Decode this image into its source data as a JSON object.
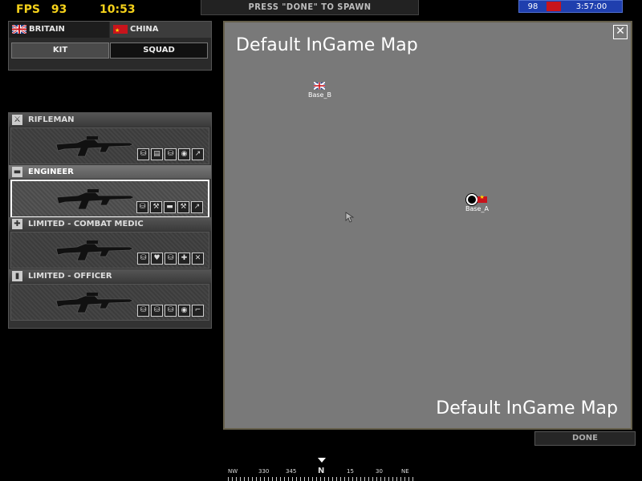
{
  "hud": {
    "fps_label": "FPS",
    "fps_value": "93",
    "clock": "10:53",
    "spawn_banner": "PRESS \"DONE\" TO SPAWN",
    "score": {
      "tickets": "98",
      "time": "3:57:00",
      "team_color": "#c8141c",
      "bar_color": "#1f3fae"
    }
  },
  "teams": [
    {
      "label": "BRITAIN",
      "flag": "uk-flag"
    },
    {
      "label": "CHINA",
      "flag": "china-flag"
    }
  ],
  "tabs": [
    {
      "label": "KIT",
      "active": true
    },
    {
      "label": "SQUAD",
      "active": false
    }
  ],
  "kits": [
    {
      "label": "RIFLEMAN",
      "icon": "rifleman-icon",
      "slots": [
        "⛁",
        "▤",
        "⛁",
        "◉",
        "↗"
      ],
      "selected": false
    },
    {
      "label": "ENGINEER",
      "icon": "engineer-icon",
      "slots": [
        "⛁",
        "⚒",
        "▬",
        "⚒",
        "↗"
      ],
      "selected": true
    },
    {
      "label": "LIMITED - COMBAT MEDIC",
      "icon": "medic-cross-icon",
      "slots": [
        "⛁",
        "♥",
        "⛁",
        "✚",
        "✕"
      ],
      "selected": false
    },
    {
      "label": "LIMITED - OFFICER",
      "icon": "officer-icon",
      "slots": [
        "⛁",
        "⛁",
        "⛁",
        "◉",
        "⌐"
      ],
      "selected": false
    }
  ],
  "map": {
    "title": "Default InGame Map",
    "title_bottom": "Default InGame Map",
    "close_symbol": "✕",
    "bases": [
      {
        "label": "Base_B",
        "owner": "uk-flag"
      },
      {
        "label": "Base_A",
        "owner": "china-flag"
      }
    ]
  },
  "done_button": "DONE",
  "compass": {
    "labels": [
      "NW",
      "330",
      "345",
      "N",
      "15",
      "30",
      "NE"
    ]
  }
}
